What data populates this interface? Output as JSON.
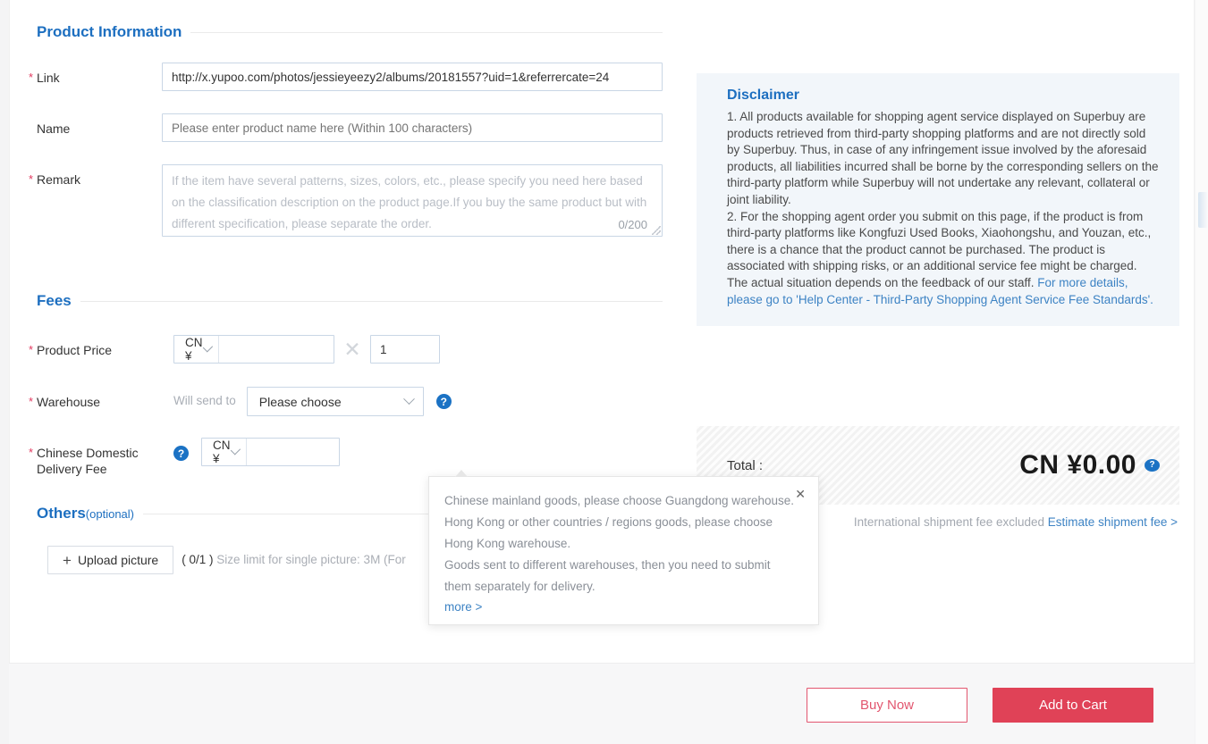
{
  "product_information": {
    "heading": "Product Information",
    "link": {
      "label": "Link",
      "value": "http://x.yupoo.com/photos/jessieyeezy2/albums/20181557?uid=1&referrercate=24",
      "required": true
    },
    "name": {
      "label": "Name",
      "value": "",
      "placeholder": "Please enter product name here (Within 100 characters)",
      "required": false
    },
    "remark": {
      "label": "Remark",
      "value": "",
      "placeholder": "If the item have several patterns, sizes, colors, etc., please specify you need here based on the classification description on the product page.If you buy the same product but with different specification, please separate the order.",
      "counter": "0/200",
      "required": true
    }
  },
  "disclaimer": {
    "heading": "Disclaimer",
    "paragraph_1": "1. All products available for shopping agent service displayed on Superbuy are products retrieved from third-party shopping platforms and are not directly sold by Superbuy. Thus, in case of any infringement issue involved by the aforesaid products, all liabilities incurred shall be borne by the corresponding sellers on the third-party platform while Superbuy will not undertake any relevant, collateral or joint liability.",
    "paragraph_2_text": "2. For the shopping agent order you submit on this page, if the product is from third-party platforms like Kongfuzi Used Books, Xiaohongshu, and Youzan, etc., there is a chance that the product cannot be purchased. The product is associated with shipping risks, or an additional service fee might be charged. The actual situation depends on the feedback of our staff. ",
    "paragraph_2_link": "For more details, please go to 'Help Center - Third-Party Shopping Agent Service Fee Standards'."
  },
  "fees": {
    "heading": "Fees",
    "product_price": {
      "label": "Product Price",
      "required": true,
      "currency": "CN ¥",
      "amount": "",
      "operator": "✕",
      "quantity": "1"
    },
    "warehouse": {
      "label": "Warehouse",
      "required": true,
      "prefix": "Will send to",
      "selected": "Please choose",
      "help_icon": "question-mark-icon"
    },
    "domestic_delivery": {
      "label_line1": "Chinese Domestic",
      "label_line2": "Delivery Fee",
      "required": true,
      "help_icon": "question-mark-icon",
      "currency": "CN ¥",
      "amount": ""
    }
  },
  "total": {
    "label": "Total :",
    "currency": "CN ¥",
    "value": "0.00",
    "amount_display": "CN ¥0.00",
    "help_icon": "question-mark-icon",
    "note_text": "International shipment fee excluded ",
    "note_link": "Estimate shipment fee >"
  },
  "others": {
    "heading": "Others",
    "heading_optional": "(optional)",
    "upload_button": "Upload picture",
    "upload_plus_icon": "plus-icon",
    "count": "( 0/1 )",
    "size_note": "Size limit for single picture: 3M (For"
  },
  "warehouse_tooltip": {
    "line1": "Chinese mainland goods, please choose Guangdong warehouse.",
    "line2": "Hong Kong or other countries / regions goods, please choose Hong Kong warehouse.",
    "line3": "Goods sent to different warehouses, then you need to submit them separately for delivery.",
    "more_link": "more >",
    "close_icon": "close-icon"
  },
  "footer": {
    "buy_now": "Buy Now",
    "add_to_cart": "Add to Cart"
  },
  "colors": {
    "brand_blue": "#1d6fc0",
    "link_blue": "#3d83c4",
    "required_red": "#e2395f",
    "primary_red": "#e04257",
    "outline_red": "#e2566f",
    "disclaimer_bg": "#f2f6fa",
    "total_bg": "#f2f2f2"
  }
}
